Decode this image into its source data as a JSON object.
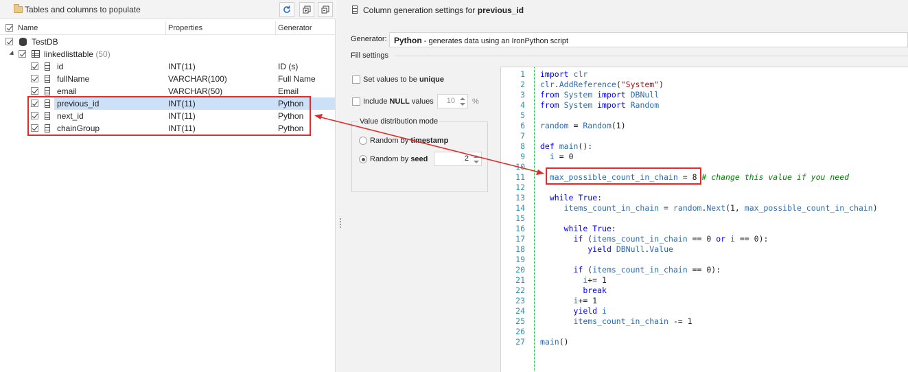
{
  "left_panel": {
    "title": "Tables and columns to populate",
    "buttons": [
      {
        "name": "refresh-icon"
      },
      {
        "name": "expand-all-icon"
      },
      {
        "name": "collapse-all-icon"
      }
    ],
    "columns": {
      "name": "Name",
      "properties": "Properties",
      "generator": "Generator"
    },
    "database": "TestDB",
    "table": {
      "name": "linkedlisttable",
      "count": "(50)"
    },
    "rows": [
      {
        "name": "id",
        "type": "INT(11)",
        "generator": "ID (s)",
        "checked": true
      },
      {
        "name": "fullName",
        "type": "VARCHAR(100)",
        "generator": "Full Name",
        "checked": true
      },
      {
        "name": "email",
        "type": "VARCHAR(50)",
        "generator": "Email",
        "checked": true
      },
      {
        "name": "previous_id",
        "type": "INT(11)",
        "generator": "Python",
        "checked": true,
        "selected": true
      },
      {
        "name": "next_id",
        "type": "INT(11)",
        "generator": "Python",
        "checked": true
      },
      {
        "name": "chainGroup",
        "type": "INT(11)",
        "generator": "Python",
        "checked": true
      }
    ]
  },
  "right_panel": {
    "title_prefix": "Column generation settings for ",
    "title_column": "previous_id",
    "generator_label": "Generator:",
    "generator_name": "Python",
    "generator_desc": " - generates data using an IronPython script",
    "fill_settings_label": "Fill settings",
    "unique_prefix": "Set values to be ",
    "unique_bold": "unique",
    "null_prefix": "Include ",
    "null_bold": "NULL",
    "null_suffix": " values",
    "null_percent": "10",
    "percent_sign": "%",
    "distribution_title": "Value distribution mode",
    "random_timestamp_prefix": "Random by ",
    "random_timestamp_bold": "timestamp",
    "random_seed_prefix": "Random by ",
    "random_seed_bold": "seed",
    "seed_value": "2"
  },
  "code_lines": [
    "import clr",
    "clr.AddReference(\"System\")",
    "from System import DBNull",
    "from System import Random",
    "",
    "random = Random(1)",
    "",
    "def main():",
    "  i = 0",
    "",
    "  max_possible_count_in_chain = 8 # change this value if you need",
    "",
    "  while True:",
    "     items_count_in_chain = random.Next(1, max_possible_count_in_chain)",
    "",
    "     while True:",
    "       if (items_count_in_chain == 0 or i == 0):",
    "          yield DBNull.Value",
    "",
    "       if (items_count_in_chain == 0):",
    "         i+= 1",
    "         break",
    "       i+= 1",
    "       yield i",
    "       items_count_in_chain -= 1",
    "",
    "main()"
  ]
}
